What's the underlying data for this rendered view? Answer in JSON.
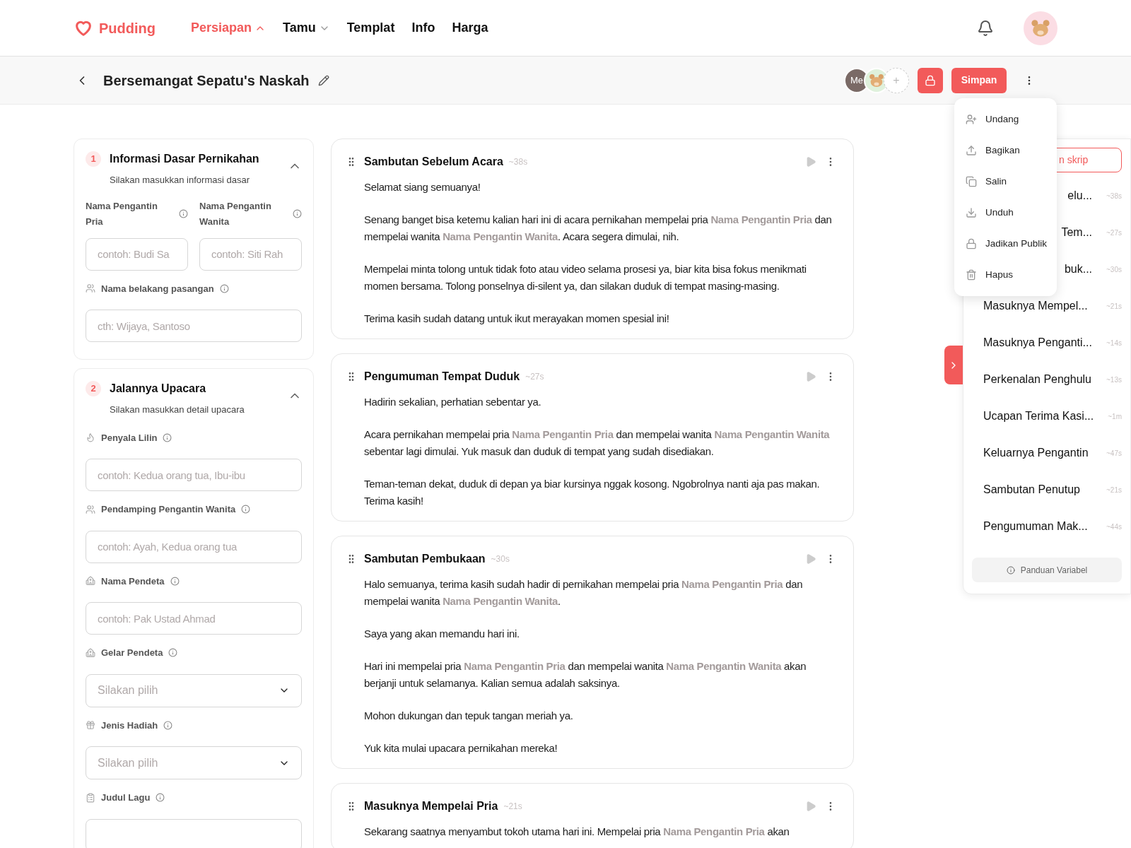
{
  "brand": {
    "name": "Pudding"
  },
  "nav": [
    {
      "label": "Persiapan",
      "selected": true,
      "expanded": true
    },
    {
      "label": "Tamu",
      "selected": false,
      "expanded": false
    },
    {
      "label": "Templat",
      "selected": false
    },
    {
      "label": "Info",
      "selected": false
    },
    {
      "label": "Harga",
      "selected": false
    }
  ],
  "toolbar": {
    "title": "Bersemangat Sepatu's Naskah",
    "me": "Me",
    "add": "+",
    "save": "Simpan"
  },
  "menu": [
    {
      "label": "Undang"
    },
    {
      "label": "Bagikan"
    },
    {
      "label": "Salin"
    },
    {
      "label": "Unduh"
    },
    {
      "label": "Jadikan Publik"
    },
    {
      "label": "Hapus"
    }
  ],
  "sections": [
    {
      "number": "1",
      "title": "Informasi Dasar Pernikahan",
      "subtitle": "Silakan masukkan informasi dasar",
      "expanded": true,
      "fields": [
        {
          "kind": "half",
          "label": "Nama Pengantin Pria",
          "placeholder": "contoh: Budi Sa"
        },
        {
          "kind": "half",
          "label": "Nama Pengantin Wanita",
          "placeholder": "contoh: Siti Rah"
        },
        {
          "kind": "input",
          "label": "Nama belakang pasangan",
          "placeholder": "cth: Wijaya, Santoso"
        }
      ]
    },
    {
      "number": "2",
      "title": "Jalannya Upacara",
      "subtitle": "Silakan masukkan detail upacara",
      "expanded": true,
      "fields": [
        {
          "kind": "input",
          "label": "Penyala Lilin",
          "placeholder": "contoh: Kedua orang tua, Ibu-ibu"
        },
        {
          "kind": "input",
          "label": "Pendamping Pengantin Wanita",
          "placeholder": "contoh: Ayah, Kedua orang tua"
        },
        {
          "kind": "input",
          "label": "Nama Pendeta",
          "placeholder": "contoh: Pak Ustad Ahmad"
        },
        {
          "kind": "select",
          "label": "Gelar Pendeta",
          "placeholder": "Silakan pilih"
        },
        {
          "kind": "select",
          "label": "Jenis Hadiah",
          "placeholder": "Silakan pilih"
        },
        {
          "kind": "input",
          "label": "Judul Lagu"
        }
      ]
    }
  ],
  "scripts": [
    {
      "title": "Sambutan Sebelum Acara",
      "duration": "~38s",
      "paragraphs": [
        "Selamat siang semuanya!",
        "Senang banget bisa ketemu kalian hari ini di acara pernikahan mempelai pria **Nama Pengantin Pria** dan mempelai wanita **Nama Pengantin Wanita**. Acara segera dimulai, nih.",
        "Mempelai minta tolong untuk tidak foto atau video selama prosesi ya, biar kita bisa fokus menikmati momen bersama. Tolong ponselnya di-silent ya, dan silakan duduk di tempat masing-masing.",
        "Terima kasih sudah datang untuk ikut merayakan momen spesial ini!"
      ]
    },
    {
      "title": "Pengumuman Tempat Duduk",
      "duration": "~27s",
      "paragraphs": [
        "Hadirin sekalian, perhatian sebentar ya.",
        "Acara pernikahan mempelai pria **Nama Pengantin Pria** dan mempelai wanita **Nama Pengantin Wanita** sebentar lagi dimulai. Yuk masuk dan duduk di tempat yang sudah disediakan.",
        "Teman-teman dekat, duduk di depan ya biar kursinya nggak kosong. Ngobrolnya nanti aja pas makan. Terima kasih!"
      ]
    },
    {
      "title": "Sambutan Pembukaan",
      "duration": "~30s",
      "paragraphs": [
        "Halo semuanya, terima kasih sudah hadir di pernikahan mempelai pria **Nama Pengantin Pria** dan mempelai wanita **Nama Pengantin Wanita**.",
        "Saya yang akan memandu hari ini.",
        "Hari ini mempelai pria **Nama Pengantin Pria** dan mempelai wanita **Nama Pengantin Wanita** akan berjanji untuk selamanya. Kalian semua adalah saksinya.",
        "Mohon dukungan dan tepuk tangan meriah ya.",
        "Yuk kita mulai upacara pernikahan mereka!"
      ]
    },
    {
      "title": "Masuknya Mempelai Pria",
      "duration": "~21s",
      "paragraphs": [
        "Sekarang saatnya menyambut tokoh utama hari ini. Mempelai pria **Nama Pengantin Pria** akan"
      ]
    }
  ],
  "outline": {
    "add_button": "n skrip",
    "items": [
      {
        "title": "elu...",
        "duration": "~38s",
        "covered": true
      },
      {
        "title": "Tem...",
        "duration": "~27s",
        "covered": true
      },
      {
        "title": "buk...",
        "duration": "~30s",
        "covered": true
      },
      {
        "title": "Masuknya Mempel...",
        "duration": "~21s",
        "covered": false
      },
      {
        "title": "Masuknya Penganti...",
        "duration": "~14s",
        "covered": false
      },
      {
        "title": "Perkenalan Penghulu",
        "duration": "~13s",
        "covered": false
      },
      {
        "title": "Ucapan Terima Kasi...",
        "duration": "~1m",
        "covered": false
      },
      {
        "title": "Keluarnya Pengantin",
        "duration": "~47s",
        "covered": false
      },
      {
        "title": "Sambutan Penutup",
        "duration": "~21s",
        "covered": false
      },
      {
        "title": "Pengumuman Mak...",
        "duration": "~44s",
        "covered": false
      }
    ],
    "guide": "Panduan Variabel"
  }
}
